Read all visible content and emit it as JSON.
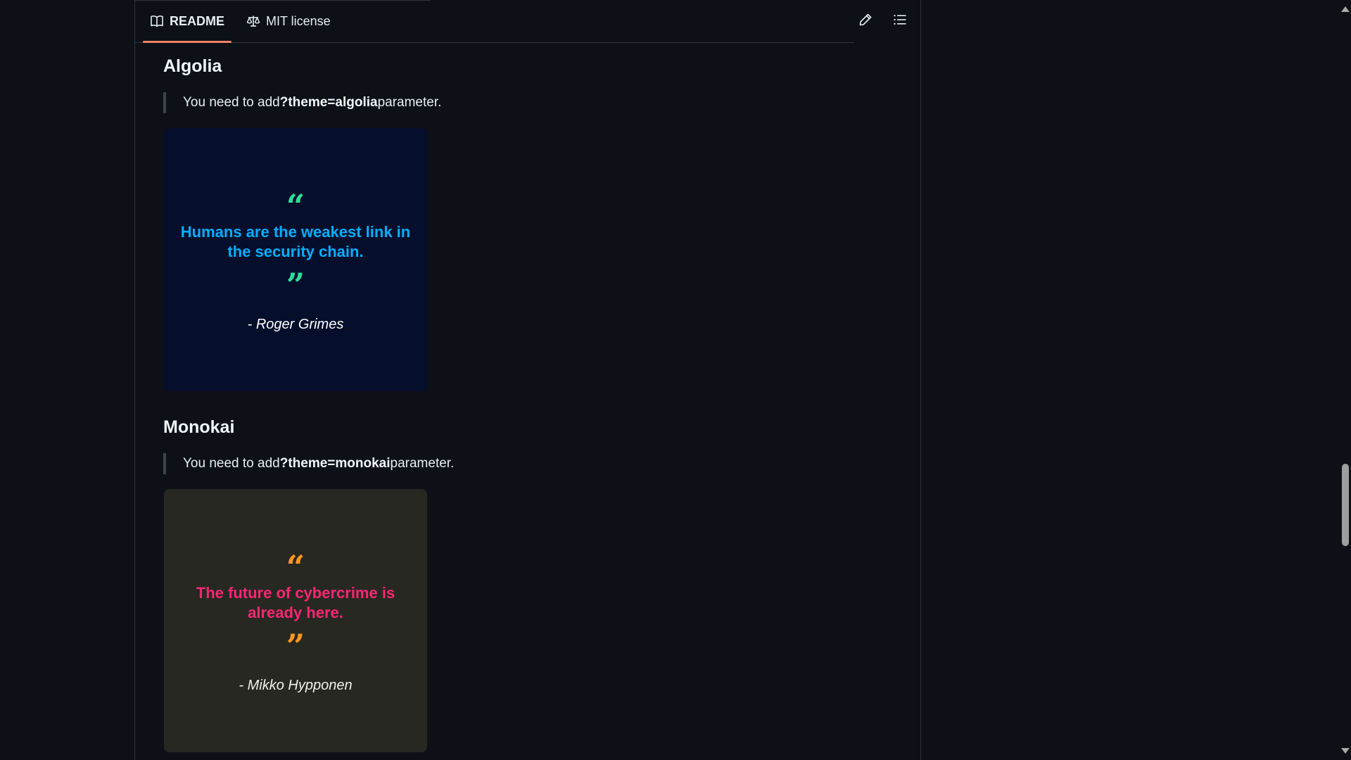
{
  "tabs": {
    "readme_label": "README",
    "license_label": "MIT license"
  },
  "toolbar": {
    "edit_icon": "pencil-icon",
    "outline_icon": "list-unordered-icon"
  },
  "sections": {
    "algolia": {
      "title": "Algolia",
      "note_prefix": "You need to add ",
      "note_param": "?theme=algolia",
      "note_suffix": " parameter.",
      "card": {
        "open_mark": "“",
        "quote": "Humans are the weakest link in the security chain.",
        "close_mark": "”",
        "author": "- Roger Grimes",
        "background": "#050f2c",
        "quote_color": "#00aeff",
        "mark_color": "#2dde98",
        "author_color": "#ffffff"
      }
    },
    "monokai": {
      "title": "Monokai",
      "note_prefix": "You need to add ",
      "note_param": "?theme=monokai",
      "note_suffix": " parameter.",
      "card": {
        "open_mark": "“",
        "quote": "The future of cybercrime is already here.",
        "close_mark": "”",
        "author": "- Mikko Hypponen",
        "background": "#272822",
        "quote_color": "#f92672",
        "mark_color": "#fd971f",
        "author_color": "#f1f1eb"
      }
    }
  },
  "colors": {
    "page_background": "#0d1117",
    "border": "#30363d",
    "active_tab_underline": "#f78166",
    "text": "#e6edf3"
  }
}
